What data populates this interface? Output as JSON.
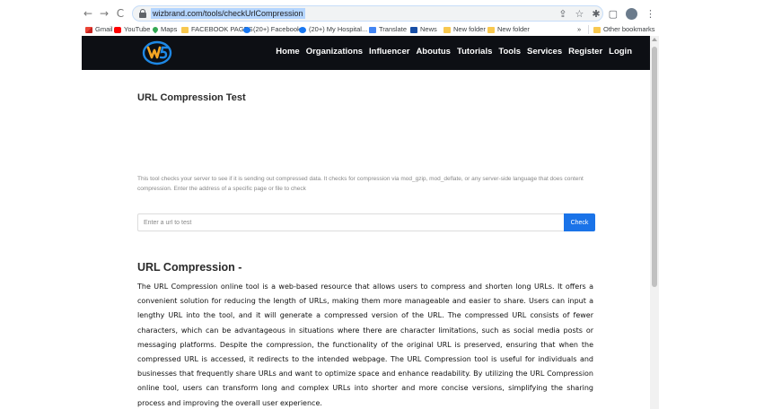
{
  "browser": {
    "url": "wizbrand.com/tools/checkUrlCompression",
    "bookmarks": [
      {
        "label": "Gmail",
        "icon": "gmail-icon"
      },
      {
        "label": "YouTube",
        "icon": "youtube-icon"
      },
      {
        "label": "Maps",
        "icon": "maps-icon"
      },
      {
        "label": "FACEBOOK PAGES",
        "icon": "folder-icon"
      },
      {
        "label": "(20+) Facebook",
        "icon": "facebook-icon"
      },
      {
        "label": "(20+) My Hospital...",
        "icon": "facebook-icon"
      },
      {
        "label": "Translate",
        "icon": "translate-icon"
      },
      {
        "label": "News",
        "icon": "news-icon"
      },
      {
        "label": "New folder",
        "icon": "folder-icon"
      },
      {
        "label": "New folder",
        "icon": "folder-icon"
      }
    ],
    "overflow": "»",
    "other_bookmarks": "Other bookmarks"
  },
  "site": {
    "logo_icon": "wizbrand-logo",
    "nav": [
      "Home",
      "Organizations",
      "Influencer",
      "Aboutus",
      "Tutorials",
      "Tools",
      "Services",
      "Register",
      "Login"
    ]
  },
  "page": {
    "title": "URL Compression Test",
    "description": "This tool checks your server to see if it is sending out compressed data. It checks for compression via mod_gzip, mod_deflate, or any server-side language that does content compression. Enter the address of a specific page or file to check",
    "input_placeholder": "Enter a url to test",
    "input_value": "",
    "check_label": "Check",
    "section_title": "URL Compression -",
    "section_body": "The URL Compression online tool is a web-based resource that allows users to compress and shorten long URLs. It offers a convenient solution for reducing the length of URLs, making them more manageable and easier to share. Users can input a lengthy URL into the tool, and it will generate a compressed version of the URL. The compressed URL consists of fewer characters, which can be advantageous in situations where there are character limitations, such as social media posts or messaging platforms. Despite the compression, the functionality of the original URL is preserved, ensuring that when the compressed URL is accessed, it redirects to the intended webpage. The URL Compression tool is useful for individuals and businesses that frequently share URLs and want to optimize space and enhance readability. By utilizing the URL Compression online tool, users can transform long and complex URLs into shorter and more concise versions, simplifying the sharing process and improving the overall user experience."
  },
  "colors": {
    "navbar_bg": "#0d0f14",
    "button_bg": "#1a73e8",
    "logo_blue": "#1e88e5",
    "logo_orange": "#f5a623"
  }
}
